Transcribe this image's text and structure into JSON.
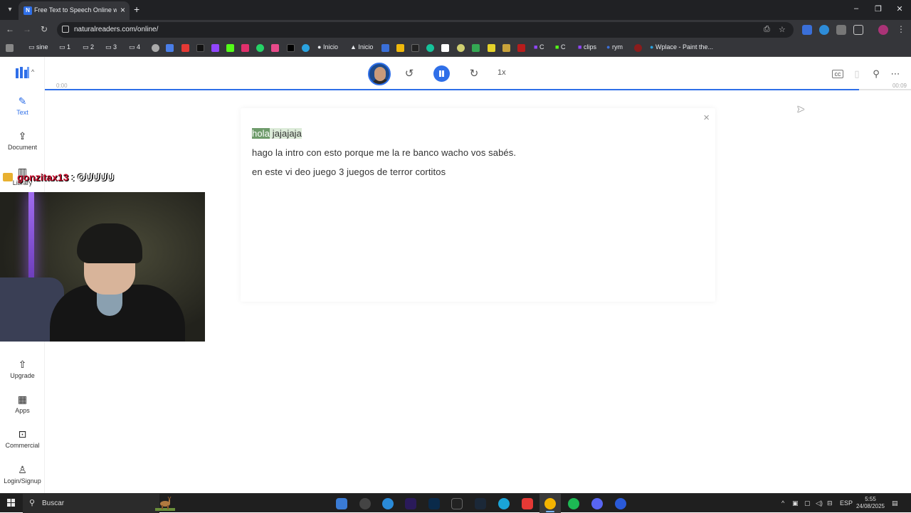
{
  "browser": {
    "tab_title": "Free Text to Speech Online with",
    "url": "naturalreaders.com/online/",
    "bookmarks": [
      {
        "label": "sine"
      },
      {
        "label": "1"
      },
      {
        "label": "2"
      },
      {
        "label": "3"
      },
      {
        "label": "4"
      },
      {
        "label": "Inicio"
      },
      {
        "label": "Inicio"
      },
      {
        "label": "C"
      },
      {
        "label": "C"
      },
      {
        "label": "clips"
      },
      {
        "label": "rym"
      },
      {
        "label": "Wplace - Paint the..."
      }
    ]
  },
  "sidebar": {
    "items": [
      {
        "label": "Text"
      },
      {
        "label": "Document"
      },
      {
        "label": "Library"
      },
      {
        "label": "Upgrade"
      },
      {
        "label": "Apps"
      },
      {
        "label": "Commercial"
      },
      {
        "label": "Login/Signup"
      }
    ]
  },
  "player": {
    "speed": "1x",
    "time_start": "0:00",
    "time_end": "00:09",
    "progress_fraction": 0.94
  },
  "document": {
    "line1_word": "hola",
    "line1_rest": "jajajaja",
    "line2": "hago la intro con esto porque me la re banco wacho vos sabés.",
    "line3": "en este vi deo juego 3 juegos de terror cortitos"
  },
  "overlay": {
    "chat_user": "gonzitax13",
    "chat_sep": " : ",
    "chat_msg": "OUUUU"
  },
  "taskbar": {
    "search": "Buscar",
    "lang": "ESP",
    "time": "5:55",
    "date": "24/08/2025"
  },
  "colors": {
    "accent": "#2f6fe8",
    "highlight_word": "#6e9b6b",
    "highlight_sentence": "#dcebd9"
  }
}
